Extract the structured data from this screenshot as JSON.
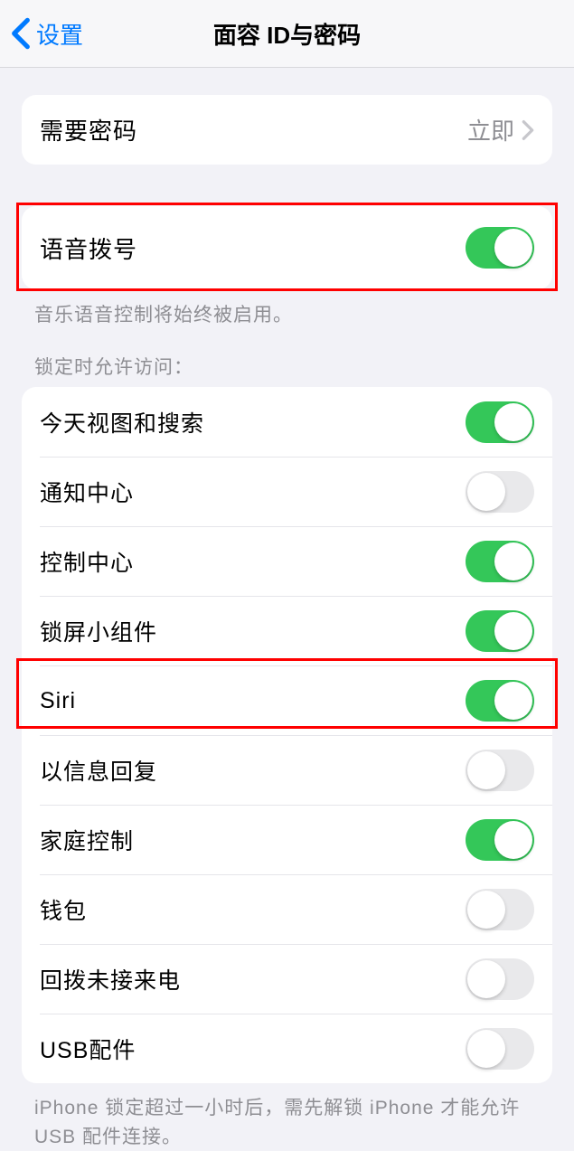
{
  "header": {
    "back_label": "设置",
    "title": "面容 ID与密码"
  },
  "require_passcode": {
    "label": "需要密码",
    "value": "立即"
  },
  "voice_dial": {
    "label": "语音拨号",
    "on": true,
    "note": "音乐语音控制将始终被启用。"
  },
  "allow_access_title": "锁定时允许访问：",
  "items": [
    {
      "label": "今天视图和搜索",
      "on": true
    },
    {
      "label": "通知中心",
      "on": false
    },
    {
      "label": "控制中心",
      "on": true
    },
    {
      "label": "锁屏小组件",
      "on": true
    },
    {
      "label": "Siri",
      "on": true
    },
    {
      "label": "以信息回复",
      "on": false
    },
    {
      "label": "家庭控制",
      "on": true
    },
    {
      "label": "钱包",
      "on": false
    },
    {
      "label": "回拨未接来电",
      "on": false
    },
    {
      "label": "USB配件",
      "on": false
    }
  ],
  "usb_note": "iPhone 锁定超过一小时后，需先解锁 iPhone 才能允许 USB 配件连接。"
}
